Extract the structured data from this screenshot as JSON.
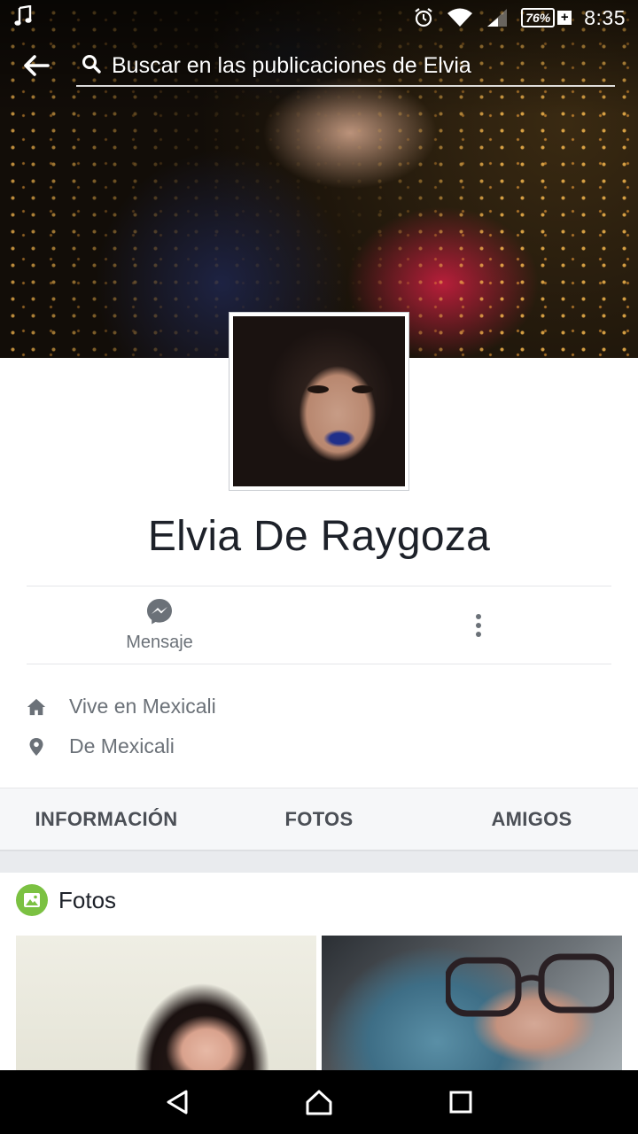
{
  "status_bar": {
    "left_icon": "music-note-icon",
    "icons": [
      "alarm-icon",
      "wifi-icon",
      "signal-icon"
    ],
    "battery": "76%",
    "battery_extra": "+",
    "time": "8:35"
  },
  "header": {
    "back_icon": "back-arrow-icon",
    "search_icon": "search-icon",
    "search_placeholder": "Buscar en las publicaciones de Elvia"
  },
  "profile": {
    "name": "Elvia De Raygoza"
  },
  "actions": {
    "message_label": "Mensaje",
    "message_icon": "messenger-icon",
    "more_icon": "more-vertical-icon"
  },
  "intro": [
    {
      "icon": "home-icon",
      "text": "Vive en Mexicali"
    },
    {
      "icon": "location-pin-icon",
      "text": "De Mexicali"
    }
  ],
  "tabs": [
    {
      "label": "INFORMACIÓN"
    },
    {
      "label": "FOTOS"
    },
    {
      "label": "AMIGOS"
    }
  ],
  "photos_section": {
    "title": "Fotos",
    "icon": "photo-icon",
    "icon_color": "#7bc142"
  },
  "nav_bar": {
    "buttons": [
      "back-triangle-icon",
      "home-outline-icon",
      "recents-square-icon"
    ]
  },
  "colors": {
    "text_primary": "#1d2129",
    "text_secondary": "#6b7178",
    "tab_background": "#f6f7f9",
    "divider": "#e9ebee"
  }
}
